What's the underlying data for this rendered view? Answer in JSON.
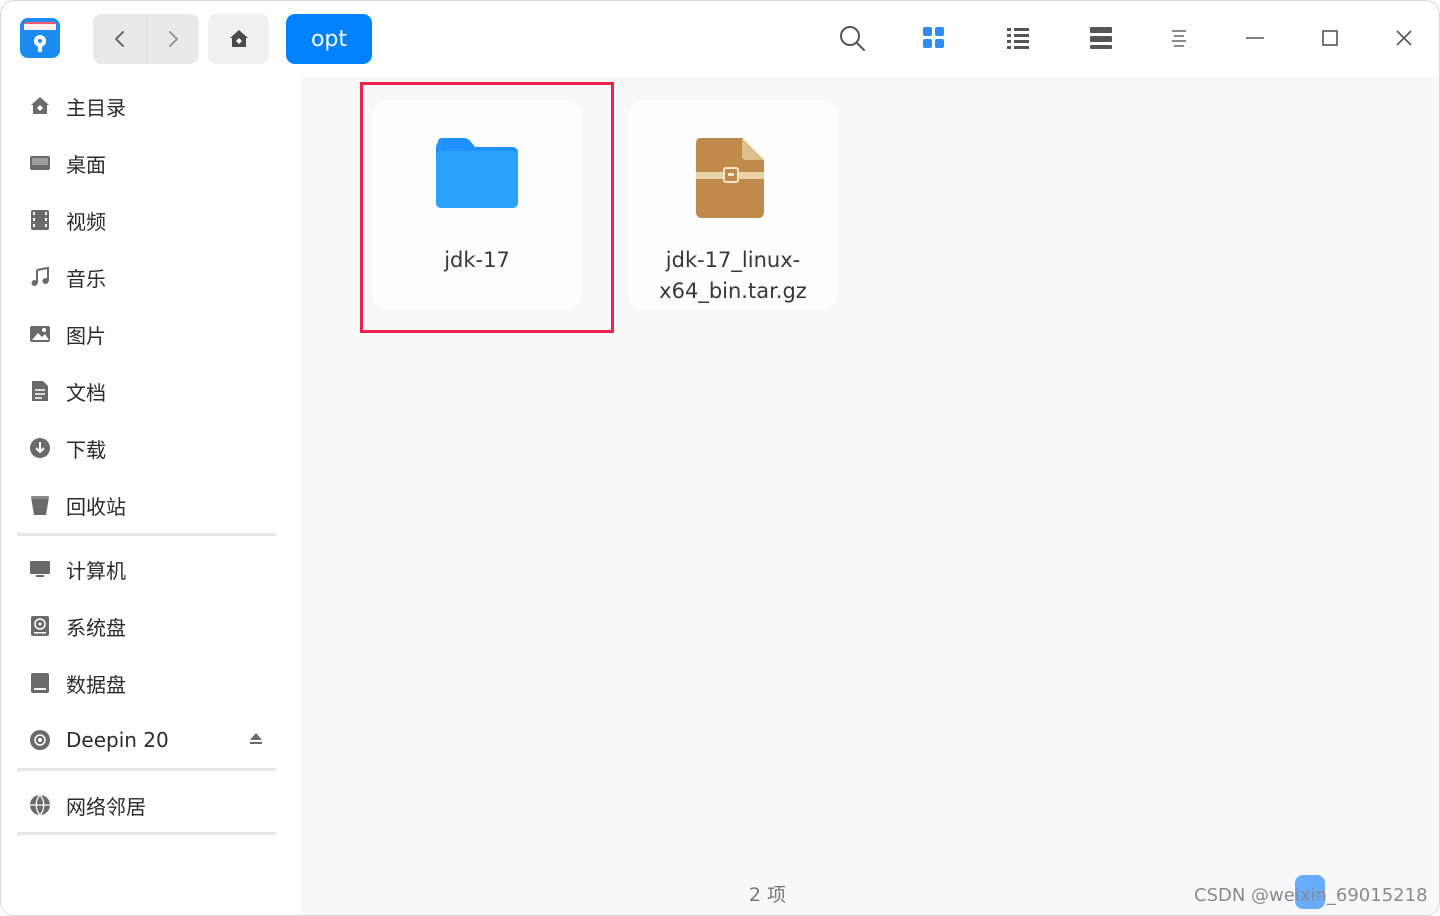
{
  "breadcrumb": {
    "current": "opt"
  },
  "toolbar": {
    "icons": [
      "search-icon",
      "icon-view-icon",
      "list-view-icon",
      "detail-view-icon",
      "menu-icon",
      "minimize-icon",
      "maximize-icon",
      "close-icon"
    ]
  },
  "sidebar": {
    "items": [
      {
        "label": "主目录",
        "icon": "home-icon"
      },
      {
        "label": "桌面",
        "icon": "desktop-icon"
      },
      {
        "label": "视频",
        "icon": "video-icon"
      },
      {
        "label": "音乐",
        "icon": "music-icon"
      },
      {
        "label": "图片",
        "icon": "pictures-icon"
      },
      {
        "label": "文档",
        "icon": "document-icon"
      },
      {
        "label": "下载",
        "icon": "download-icon"
      },
      {
        "label": "回收站",
        "icon": "trash-icon"
      },
      {
        "label": "计算机",
        "icon": "computer-icon"
      },
      {
        "label": "系统盘",
        "icon": "system-disk-icon"
      },
      {
        "label": "数据盘",
        "icon": "data-disk-icon"
      },
      {
        "label": "Deepin 20",
        "icon": "optical-disc-icon"
      },
      {
        "label": "网络邻居",
        "icon": "network-icon"
      }
    ]
  },
  "files": [
    {
      "name": "jdk-17",
      "type": "folder",
      "selected": true
    },
    {
      "name": "jdk-17_linux-x64_bin.tar.gz",
      "name_line1": "jdk-17_linux-",
      "name_line2": "x64_bin.tar.gz",
      "type": "archive"
    }
  ],
  "status": {
    "count_text": "2 项"
  },
  "watermark": {
    "text": "CSDN @weixin_69015218"
  },
  "colors": {
    "accent": "#0081ff",
    "highlight": "#e8244c",
    "folder": "#1e90ff",
    "archive": "#c08a4a"
  }
}
